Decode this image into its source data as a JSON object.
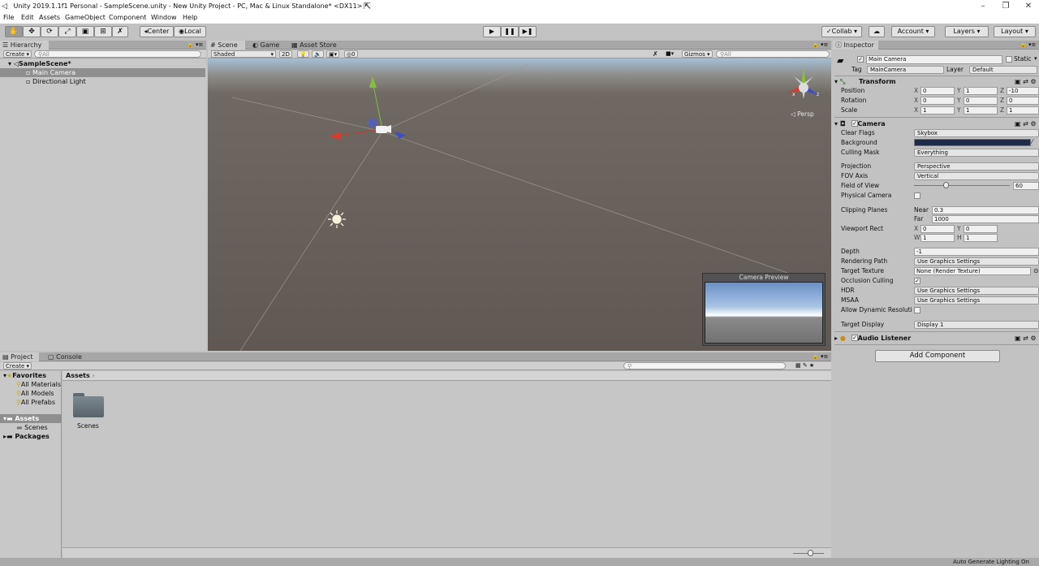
{
  "window": {
    "title": "Unity 2019.1.1f1 Personal - SampleScene.unity - New Unity Project - PC, Mac & Linux Standalone* <DX11>",
    "minimize": "–",
    "maximize": "❐",
    "close": "✕"
  },
  "menu": [
    "File",
    "Edit",
    "Assets",
    "GameObject",
    "Component",
    "Window",
    "Help"
  ],
  "toolbar": {
    "tools": [
      "hand-icon",
      "move-icon",
      "rotate-icon",
      "scale-icon",
      "rect-icon",
      "transform-icon",
      "custom-tool-icon"
    ],
    "pivot_label": "Center",
    "space_label": "Local",
    "play": "▶",
    "pause": "❚❚",
    "step": "▶❚",
    "collab": "Collab ▾",
    "account": "Account",
    "layers": "Layers",
    "layout": "Layout"
  },
  "hierarchy": {
    "tab": "Hierarchy",
    "create": "Create ▾",
    "search_placeholder": "All",
    "scene": "SampleScene*",
    "items": [
      "Main Camera",
      "Directional Light"
    ]
  },
  "scene_tabs": [
    "Scene",
    "Game",
    "Asset Store"
  ],
  "scene_toolbar": {
    "shading": "Shaded",
    "mode_2d": "2D",
    "hidden_count": "0",
    "gizmos": "Gizmos",
    "search_placeholder": "All",
    "persp": "Persp"
  },
  "camera_preview": {
    "title": "Camera Preview"
  },
  "inspector": {
    "tab": "Inspector",
    "object_name": "Main Camera",
    "static_label": "Static",
    "tag_label": "Tag",
    "tag_value": "MainCamera",
    "layer_label": "Layer",
    "layer_value": "Default",
    "transform": {
      "title": "Transform",
      "position_label": "Position",
      "position": [
        "0",
        "1",
        "-10"
      ],
      "rotation_label": "Rotation",
      "rotation": [
        "0",
        "0",
        "0"
      ],
      "scale_label": "Scale",
      "scale": [
        "1",
        "1",
        "1"
      ]
    },
    "camera": {
      "title": "Camera",
      "clear_flags_label": "Clear Flags",
      "clear_flags": "Skybox",
      "background_label": "Background",
      "background_color": "#1c2b4a",
      "culling_mask_label": "Culling Mask",
      "culling_mask": "Everything",
      "projection_label": "Projection",
      "projection": "Perspective",
      "fov_axis_label": "FOV Axis",
      "fov_axis": "Vertical",
      "fov_label": "Field of View",
      "fov": "60",
      "fov_slider": 0.33,
      "physical_camera_label": "Physical Camera",
      "clipping_planes_label": "Clipping Planes",
      "near_label": "Near",
      "near": "0.3",
      "far_label": "Far",
      "far": "1000",
      "viewport_label": "Viewport Rect",
      "viewport_x": "0",
      "viewport_y": "0",
      "viewport_w": "1",
      "viewport_h": "1",
      "depth_label": "Depth",
      "depth": "-1",
      "rendering_path_label": "Rendering Path",
      "rendering_path": "Use Graphics Settings",
      "target_texture_label": "Target Texture",
      "target_texture": "None (Render Texture)",
      "occlusion_label": "Occlusion Culling",
      "hdr_label": "HDR",
      "hdr": "Use Graphics Settings",
      "msaa_label": "MSAA",
      "msaa": "Use Graphics Settings",
      "dynamic_res_label": "Allow Dynamic Resoluti",
      "target_display_label": "Target Display",
      "target_display": "Display 1"
    },
    "audio_listener": {
      "title": "Audio Listener"
    },
    "add_component": "Add Component"
  },
  "project": {
    "tabs": [
      "Project",
      "Console"
    ],
    "create": "Create ▾",
    "favorites_label": "Favorites",
    "favorites": [
      "All Materials",
      "All Models",
      "All Prefabs"
    ],
    "assets_label": "Assets",
    "assets_children": [
      "Scenes"
    ],
    "packages_label": "Packages",
    "breadcrumb": "Assets",
    "items": [
      "Scenes"
    ]
  },
  "status": {
    "text": "Auto Generate Lighting On"
  }
}
